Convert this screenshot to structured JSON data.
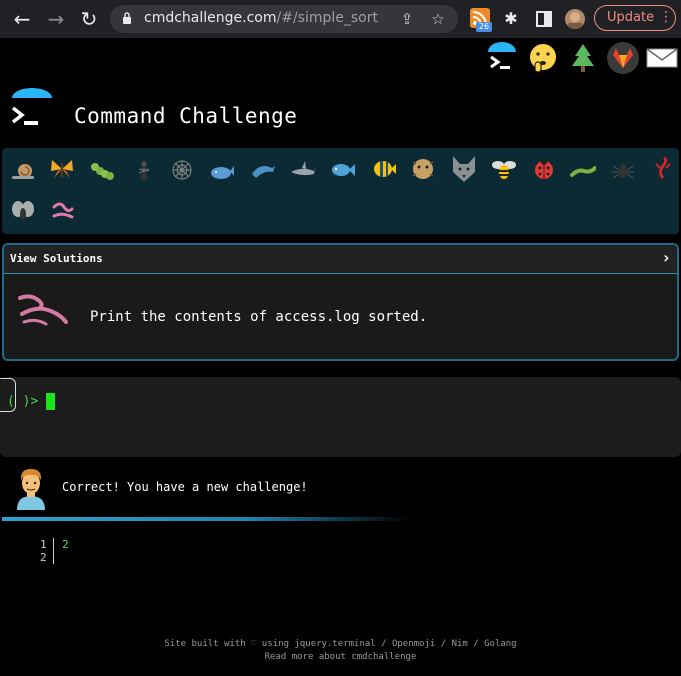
{
  "browser": {
    "url_host": "cmdchallenge.com",
    "url_path": "/#/simple_sort",
    "extension_badge": "26",
    "update_label": "Update"
  },
  "top_icons": [
    "terminal-icon",
    "shushing-face-icon",
    "tree-icon",
    "gitlab-icon",
    "mail-icon"
  ],
  "header": {
    "title": "Command Challenge"
  },
  "progress": {
    "animals": [
      "snail-icon",
      "butterfly-icon",
      "caterpillar-icon",
      "ant-icon",
      "spiderweb-icon",
      "whale-icon",
      "dolphin-icon",
      "shark-icon",
      "fish-icon",
      "tropical-fish-icon",
      "blowfish-icon",
      "wolf-icon",
      "bee-icon",
      "ladybug-icon",
      "lizard-icon",
      "spider-icon",
      "scorpion-icon",
      "fly-icon",
      "worm-icon"
    ]
  },
  "card": {
    "header_label": "View Solutions",
    "chevron": "›",
    "task": "Print the contents of access.log sorted."
  },
  "terminal": {
    "prompt": "( )>"
  },
  "result": {
    "message": "Correct! You have a new challenge!"
  },
  "output": {
    "lines": [
      {
        "num": "1",
        "value": "2"
      },
      {
        "num": "2",
        "value": ""
      }
    ]
  },
  "footer": {
    "line1": "Site built with ♡ using jquery.terminal / Openmoji / Nim / Golang",
    "line2": "Read more about cmdchallenge"
  },
  "colors": {
    "accent": "#2aa3d0",
    "prompt_green": "#4ad54a",
    "update_red": "#f28b82",
    "panel_teal": "#0b2a33"
  }
}
